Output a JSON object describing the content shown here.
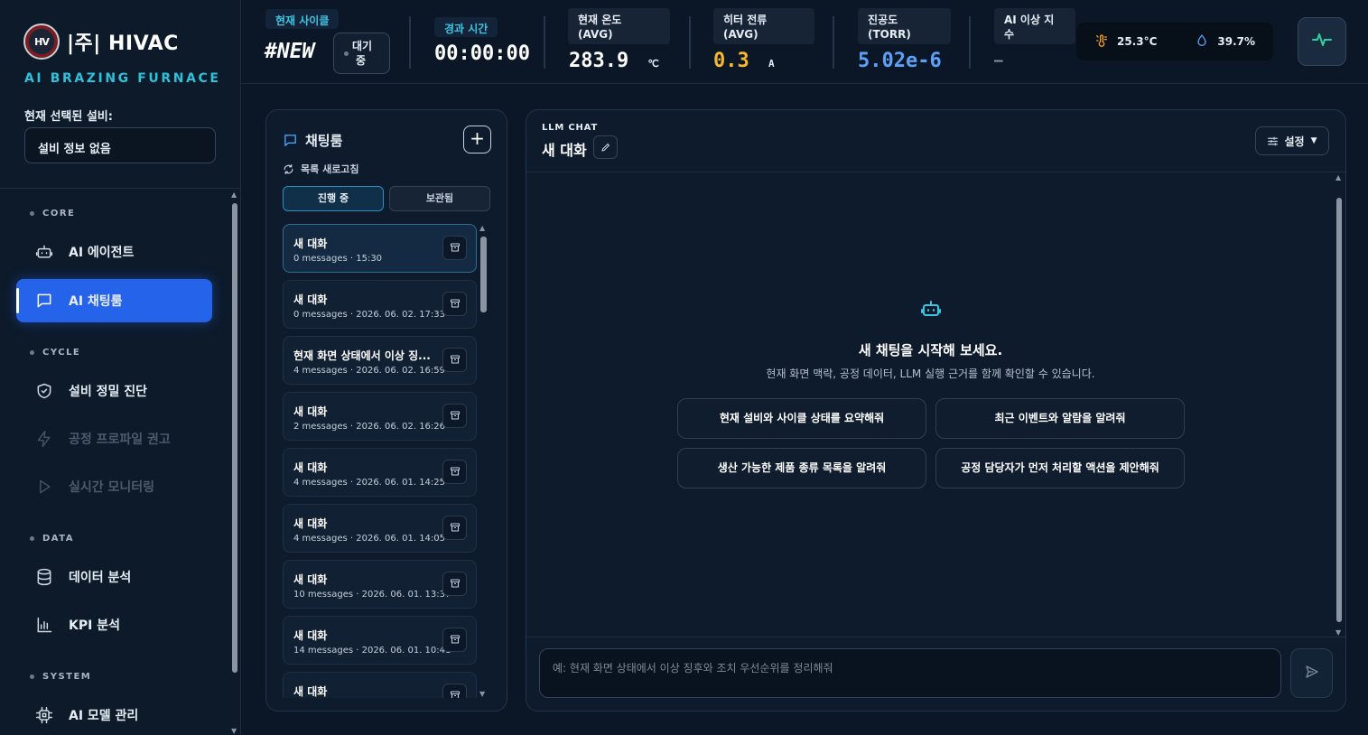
{
  "brand": {
    "logo_mark": "HV",
    "name": "|주| HIVAC",
    "tagline": "AI BRAZING FURNACE",
    "selected_equipment_label": "현재 선택된 설비:",
    "selected_equipment_value": "설비 정보 없음"
  },
  "nav": {
    "sections": [
      {
        "label": "CORE",
        "items": [
          {
            "label": "AI 에이전트",
            "icon": "robot-icon",
            "state": "normal"
          },
          {
            "label": "AI 채팅룸",
            "icon": "chat-bubble-icon",
            "state": "active"
          }
        ]
      },
      {
        "label": "CYCLE",
        "items": [
          {
            "label": "설비 정밀 진단",
            "icon": "shield-icon",
            "state": "normal"
          },
          {
            "label": "공정 프로파일 권고",
            "icon": "lightning-icon",
            "state": "disabled"
          },
          {
            "label": "실시간 모니터링",
            "icon": "play-icon",
            "state": "disabled"
          }
        ]
      },
      {
        "label": "DATA",
        "items": [
          {
            "label": "데이터 분석",
            "icon": "database-icon",
            "state": "normal"
          },
          {
            "label": "KPI 분석",
            "icon": "bar-chart-icon",
            "state": "normal"
          }
        ]
      },
      {
        "label": "SYSTEM",
        "items": [
          {
            "label": "AI 모델 관리",
            "icon": "chip-icon",
            "state": "normal"
          }
        ]
      }
    ]
  },
  "header": {
    "cycle_tag": "현재 사이클",
    "cycle_value": "#NEW",
    "status_line1": "대기",
    "status_line2": "중",
    "elapsed_tag": "경과 시간",
    "elapsed_value": "00:00:00",
    "temp_label_line1": "현재 온도",
    "temp_label_line2": "(AVG)",
    "temp_value": "283.9",
    "temp_unit": "℃",
    "heater_label_line1": "히터 전류",
    "heater_label_line2": "(AVG)",
    "heater_value": "0.3",
    "heater_unit": "A",
    "vacuum_label_line1": "진공도",
    "vacuum_label_line2": "(TORR)",
    "vacuum_value": "5.02e-6",
    "anomaly_label_line1": "AI 이상 지",
    "anomaly_label_line2": "수",
    "anomaly_value": "—",
    "env_temp": "25.3°C",
    "env_humidity": "39.7%",
    "colors": {
      "temp": "#ffffff",
      "heater": "#f5b82e",
      "vacuum": "#5ea0f5",
      "accent": "#2fc1da",
      "active": "#2563eb"
    }
  },
  "chat_list": {
    "title": "채팅룸",
    "add_label": "+",
    "refresh_label": "목록 새로고침",
    "tabs": [
      "진행 중",
      "보관됨"
    ],
    "items": [
      {
        "title": "새 대화",
        "meta": "0 messages · 15:30",
        "selected": true
      },
      {
        "title": "새 대화",
        "meta": "0 messages · 2026. 06. 02. 17:33",
        "selected": false
      },
      {
        "title": "현재 화면 상태에서 이상 징...",
        "meta": "4 messages · 2026. 06. 02. 16:59",
        "selected": false
      },
      {
        "title": "새 대화",
        "meta": "2 messages · 2026. 06. 02. 16:26",
        "selected": false
      },
      {
        "title": "새 대화",
        "meta": "4 messages · 2026. 06. 01. 14:25",
        "selected": false
      },
      {
        "title": "새 대화",
        "meta": "4 messages · 2026. 06. 01. 14:05",
        "selected": false
      },
      {
        "title": "새 대화",
        "meta": "10 messages · 2026. 06. 01. 13:37",
        "selected": false
      },
      {
        "title": "새 대화",
        "meta": "14 messages · 2026. 06. 01. 10:41",
        "selected": false
      },
      {
        "title": "새 대화",
        "meta": "",
        "selected": false
      }
    ]
  },
  "chat": {
    "kicker": "LLM CHAT",
    "title": "새 대화",
    "settings_label": "설정",
    "empty_title": "새 채팅을 시작해 보세요.",
    "empty_subtitle": "현재 화면 맥락, 공정 데이터, LLM 실행 근거를 함께 확인할 수 있습니다.",
    "suggestions": [
      "현재 설비와 사이클 상태를 요약해줘",
      "최근 이벤트와 알람을 알려줘",
      "생산 가능한 제품 종류 목록을 알려줘",
      "공정 담당자가 먼저 처리할 액션을 제안해줘"
    ],
    "input_placeholder": "예: 현재 화면 상태에서 이상 징후와 조치 우선순위를 정리해줘"
  }
}
